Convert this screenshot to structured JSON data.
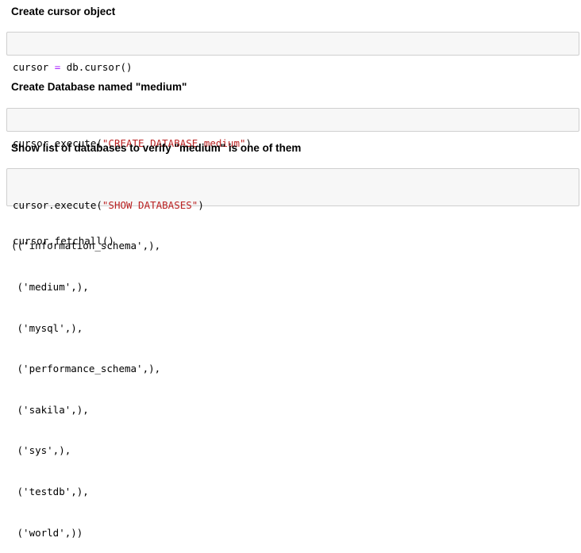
{
  "cells": [
    {
      "heading": "Create cursor object",
      "code_lines": [
        [
          {
            "t": "cursor ",
            "k": "plain"
          },
          {
            "t": "=",
            "k": "op"
          },
          {
            "t": " db.cursor()",
            "k": "plain"
          }
        ]
      ]
    },
    {
      "heading": "Create Database named \"medium\"",
      "code_lines": [
        [
          {
            "t": "cursor.execute(",
            "k": "plain"
          },
          {
            "t": "\"CREATE DATABASE medium\"",
            "k": "str"
          },
          {
            "t": ")",
            "k": "plain"
          }
        ]
      ]
    },
    {
      "heading": "Show list of databases to verify \"medium\" is one of them",
      "code_lines": [
        [
          {
            "t": "cursor.execute(",
            "k": "plain"
          },
          {
            "t": "\"SHOW DATABASES\"",
            "k": "str"
          },
          {
            "t": ")",
            "k": "plain"
          }
        ],
        [
          {
            "t": "cursor.fetchall()",
            "k": "plain"
          }
        ]
      ]
    }
  ],
  "output_lines": [
    "(('information_schema',),",
    " ('medium',),",
    " ('mysql',),",
    " ('performance_schema',),",
    " ('sakila',),",
    " ('sys',),",
    " ('testdb',),",
    " ('world',))"
  ],
  "colors": {
    "operator": "#aa22ff",
    "string": "#ba2121",
    "cell_background": "#f7f7f7",
    "cell_border": "#cfcfcf"
  }
}
